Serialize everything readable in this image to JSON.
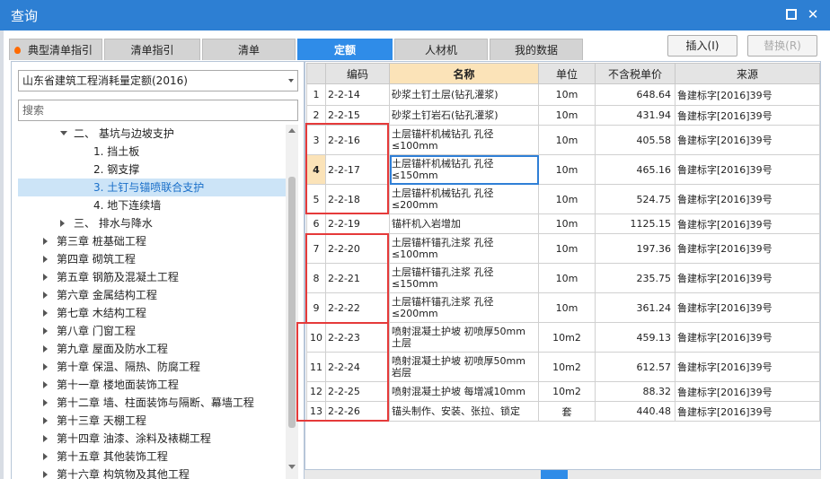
{
  "window": {
    "title": "查询"
  },
  "tabs": [
    {
      "label": "典型清单指引"
    },
    {
      "label": "清单指引"
    },
    {
      "label": "清单"
    },
    {
      "label": "定额"
    },
    {
      "label": "人材机"
    },
    {
      "label": "我的数据"
    }
  ],
  "actions": {
    "insert_label": "插入(I)",
    "replace_label": "替换(R)"
  },
  "left": {
    "library_select": "山东省建筑工程消耗量定额(2016)",
    "search_placeholder": "搜索",
    "tree": [
      {
        "label": "二、 基坑与边坡支护",
        "level": 1,
        "expanded": true
      },
      {
        "label": "1. 挡土板",
        "level": 2
      },
      {
        "label": "2. 钢支撑",
        "level": 2
      },
      {
        "label": "3. 土钉与锚喷联合支护",
        "level": 2,
        "selected": true
      },
      {
        "label": "4. 地下连续墙",
        "level": 2
      },
      {
        "label": "三、 排水与降水",
        "level": 1
      },
      {
        "label": "第三章 桩基础工程",
        "level": 0
      },
      {
        "label": "第四章 砌筑工程",
        "level": 0
      },
      {
        "label": "第五章 钢筋及混凝土工程",
        "level": 0
      },
      {
        "label": "第六章 金属结构工程",
        "level": 0
      },
      {
        "label": "第七章 木结构工程",
        "level": 0
      },
      {
        "label": "第八章 门窗工程",
        "level": 0
      },
      {
        "label": "第九章 屋面及防水工程",
        "level": 0
      },
      {
        "label": "第十章 保温、隔热、防腐工程",
        "level": 0
      },
      {
        "label": "第十一章 楼地面装饰工程",
        "level": 0
      },
      {
        "label": "第十二章 墙、柱面装饰与隔断、幕墙工程",
        "level": 0
      },
      {
        "label": "第十三章 天棚工程",
        "level": 0
      },
      {
        "label": "第十四章 油漆、涂料及裱糊工程",
        "level": 0
      },
      {
        "label": "第十五章 其他装饰工程",
        "level": 0
      },
      {
        "label": "第十六章 构筑物及其他工程",
        "level": 0
      }
    ]
  },
  "grid": {
    "columns": [
      "",
      "编码",
      "名称",
      "单位",
      "不含税单价",
      "来源"
    ],
    "rows": [
      {
        "no": "1",
        "code": "2-2-14",
        "name": "砂浆土钉土层(钻孔灌浆)",
        "unit": "10m",
        "price": "648.64",
        "source": "鲁建标字[2016]39号"
      },
      {
        "no": "2",
        "code": "2-2-15",
        "name": "砂浆土钉岩石(钻孔灌浆)",
        "unit": "10m",
        "price": "431.94",
        "source": "鲁建标字[2016]39号"
      },
      {
        "no": "3",
        "code": "2-2-16",
        "name": "土层锚杆机械钻孔 孔径≤100mm",
        "unit": "10m",
        "price": "405.58",
        "source": "鲁建标字[2016]39号"
      },
      {
        "no": "4",
        "code": "2-2-17",
        "name": "土层锚杆机械钻孔 孔径≤150mm",
        "unit": "10m",
        "price": "465.16",
        "source": "鲁建标字[2016]39号"
      },
      {
        "no": "5",
        "code": "2-2-18",
        "name": "土层锚杆机械钻孔 孔径≤200mm",
        "unit": "10m",
        "price": "524.75",
        "source": "鲁建标字[2016]39号"
      },
      {
        "no": "6",
        "code": "2-2-19",
        "name": "锚杆机入岩增加",
        "unit": "10m",
        "price": "1125.15",
        "source": "鲁建标字[2016]39号"
      },
      {
        "no": "7",
        "code": "2-2-20",
        "name": "土层锚杆锚孔注浆 孔径≤100mm",
        "unit": "10m",
        "price": "197.36",
        "source": "鲁建标字[2016]39号"
      },
      {
        "no": "8",
        "code": "2-2-21",
        "name": "土层锚杆锚孔注浆 孔径≤150mm",
        "unit": "10m",
        "price": "235.75",
        "source": "鲁建标字[2016]39号"
      },
      {
        "no": "9",
        "code": "2-2-22",
        "name": "土层锚杆锚孔注浆 孔径≤200mm",
        "unit": "10m",
        "price": "361.24",
        "source": "鲁建标字[2016]39号"
      },
      {
        "no": "10",
        "code": "2-2-23",
        "name": "喷射混凝土护坡 初喷厚50mm 土层",
        "unit": "10m2",
        "price": "459.13",
        "source": "鲁建标字[2016]39号"
      },
      {
        "no": "11",
        "code": "2-2-24",
        "name": "喷射混凝土护坡 初喷厚50mm 岩层",
        "unit": "10m2",
        "price": "612.57",
        "source": "鲁建标字[2016]39号"
      },
      {
        "no": "12",
        "code": "2-2-25",
        "name": "喷射混凝土护坡 每增减10mm",
        "unit": "10m2",
        "price": "88.32",
        "source": "鲁建标字[2016]39号"
      },
      {
        "no": "13",
        "code": "2-2-26",
        "name": "锚头制作、安装、张拉、锁定",
        "unit": "套",
        "price": "440.48",
        "source": "鲁建标字[2016]39号"
      }
    ]
  }
}
